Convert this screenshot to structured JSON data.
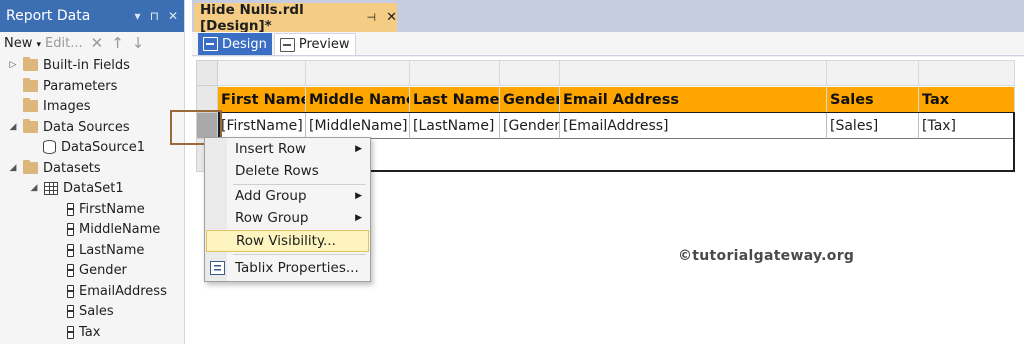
{
  "left_panel": {
    "title": "Report Data",
    "title_buttons": [
      "▾",
      "⊓",
      "✕"
    ],
    "toolbar": {
      "new_label": "New",
      "new_arrow": "▾",
      "edit_label": "Edit...",
      "delete_icon": "✕",
      "up_icon": "↑",
      "down_icon": "↓"
    },
    "tree": [
      {
        "label": "Built-in Fields",
        "icon": "folder-icon",
        "expander": "▷"
      },
      {
        "label": "Parameters",
        "icon": "folder-icon",
        "expander": ""
      },
      {
        "label": "Images",
        "icon": "folder-icon",
        "expander": ""
      },
      {
        "label": "Data Sources",
        "icon": "folder-icon",
        "expander": "◢"
      },
      {
        "label": "DataSource1",
        "icon": "datasource-icon",
        "expander": ""
      },
      {
        "label": "Datasets",
        "icon": "folder-icon",
        "expander": "◢"
      },
      {
        "label": "DataSet1",
        "icon": "dataset-icon",
        "expander": "◢"
      },
      {
        "label": "FirstName",
        "icon": "field-icon"
      },
      {
        "label": "MiddleName",
        "icon": "field-icon"
      },
      {
        "label": "LastName",
        "icon": "field-icon"
      },
      {
        "label": "Gender",
        "icon": "field-icon"
      },
      {
        "label": "EmailAddress",
        "icon": "field-icon"
      },
      {
        "label": "Sales",
        "icon": "field-icon"
      },
      {
        "label": "Tax",
        "icon": "field-icon"
      }
    ]
  },
  "document_tab": {
    "title": "Hide Nulls.rdl [Design]*",
    "pin": "⊣",
    "close": "✕"
  },
  "view_tabs": [
    {
      "label": "Design",
      "active": true
    },
    {
      "label": "Preview",
      "active": false
    }
  ],
  "tablix": {
    "headers": [
      "First Name",
      "Middle Name",
      "Last Name",
      "Gender",
      "Email Address",
      "Sales",
      "Tax"
    ],
    "fields": [
      "[FirstName]",
      "[MiddleName]",
      "[LastName]",
      "[Gender]",
      "[EmailAddress]",
      "[Sales]",
      "[Tax]"
    ],
    "header_color": "#ffa500"
  },
  "context_menu": {
    "items": [
      {
        "label": "Insert Row",
        "submenu": true
      },
      {
        "label": "Delete Rows",
        "submenu": false
      },
      {
        "label": "Add Group",
        "submenu": true
      },
      {
        "label": "Row Group",
        "submenu": true
      },
      {
        "label": "Row Visibility...",
        "submenu": false,
        "highlighted": true
      },
      {
        "label": "Tablix Properties...",
        "submenu": false,
        "icon": "tablix-properties-icon"
      }
    ],
    "submenu_arrow": "▶"
  },
  "watermark": "©tutorialgateway.org",
  "colors": {
    "panel_title": "#3c6eb4",
    "tab_active": "#f5cc84",
    "design_tab": "#3a6fc4"
  }
}
